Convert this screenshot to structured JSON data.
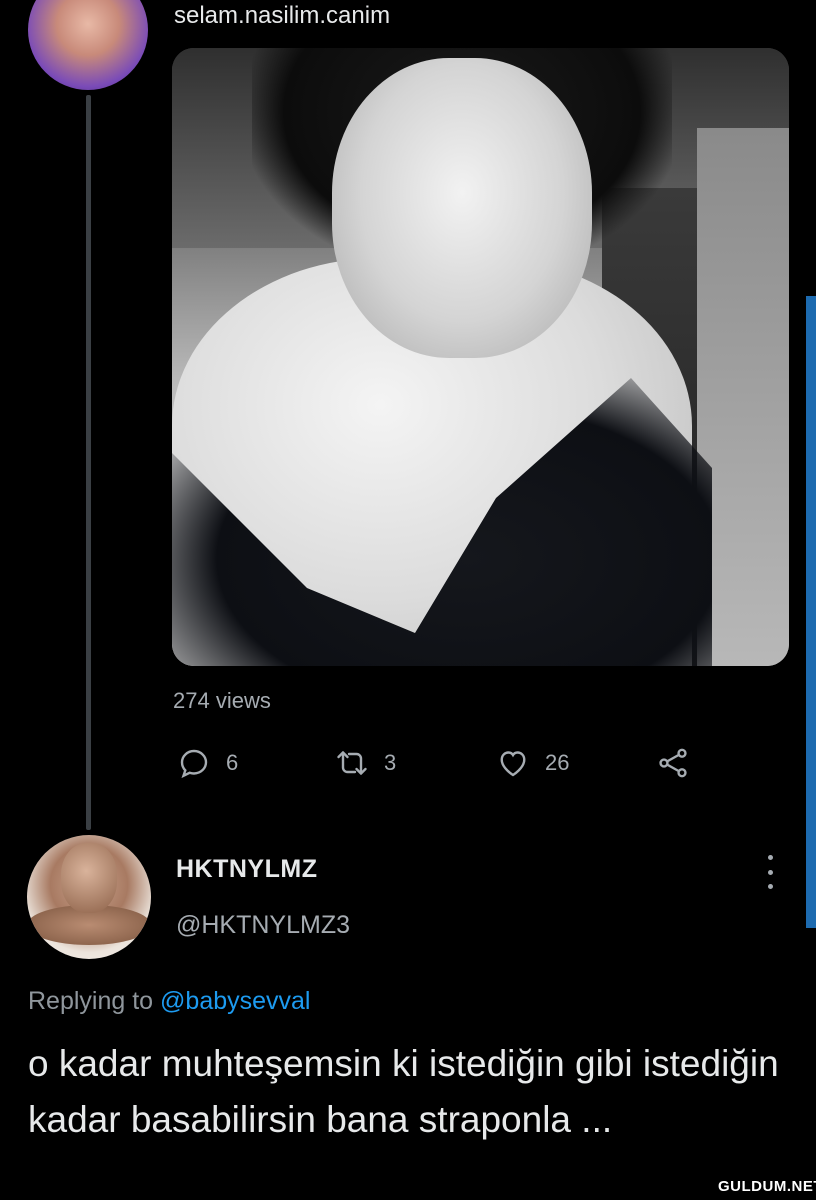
{
  "top_tweet": {
    "caption": "selam.nasilim.canim",
    "views": "274 views",
    "actions": {
      "reply_count": "6",
      "retweet_count": "3",
      "like_count": "26"
    }
  },
  "reply": {
    "display_name": "HKTNYLMZ",
    "handle": "@HKTNYLMZ3",
    "replying_prefix": "Replying to",
    "replying_to": "@babysevval",
    "text": "o kadar muhteşemsin ki istediğin gibi istediğin kadar basabilirsin bana straponla ..."
  },
  "watermark": "GULDUM.NET",
  "colors": {
    "background": "#000000",
    "text_primary": "#e7e9ea",
    "text_secondary": "#a6acb2",
    "link": "#1d9bf0",
    "scrollbar": "#1d6bb0"
  },
  "icons": [
    "reply-icon",
    "retweet-icon",
    "heart-icon",
    "share-icon",
    "more-options-icon"
  ]
}
